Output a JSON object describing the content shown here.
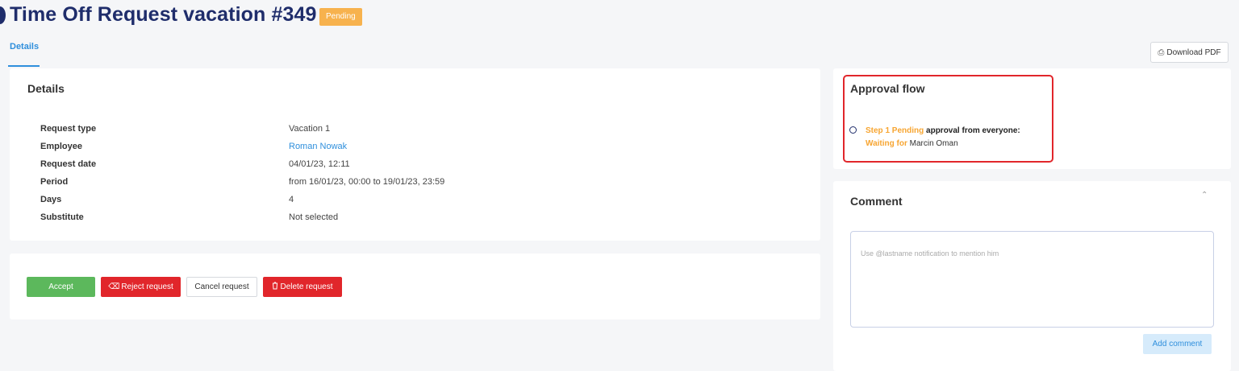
{
  "header": {
    "title": "Time Off Request vacation #349",
    "status": "Pending"
  },
  "tabs": [
    {
      "label": "Details"
    }
  ],
  "toolbar": {
    "download_label": "Download PDF"
  },
  "details": {
    "title": "Details",
    "rows": [
      {
        "label": "Request type",
        "value": "Vacation 1"
      },
      {
        "label": "Employee",
        "value": "Roman Nowak"
      },
      {
        "label": "Request date",
        "value": "04/01/23, 12:11"
      },
      {
        "label": "Period",
        "value": "from 16/01/23, 00:00 to 19/01/23, 23:59"
      },
      {
        "label": "Days",
        "value": "4"
      },
      {
        "label": "Substitute",
        "value": "Not selected"
      }
    ]
  },
  "actions": {
    "accept": "Accept",
    "reject": "Reject request",
    "cancel": "Cancel request",
    "delete": "Delete request"
  },
  "approval": {
    "title": "Approval flow",
    "step": "Step 1",
    "status": "Pending",
    "text": "approval from everyone:",
    "waiting_label": "Waiting for",
    "approver": "Marcin Oman"
  },
  "comment": {
    "title": "Comment",
    "placeholder": "Use @lastname notification to mention him",
    "add_label": "Add comment"
  },
  "colors": {
    "title": "#1f2d6b",
    "accent": "#2f8fdc",
    "pending": "#f7b24e",
    "danger": "#e1262b",
    "success": "#5cb85c"
  }
}
